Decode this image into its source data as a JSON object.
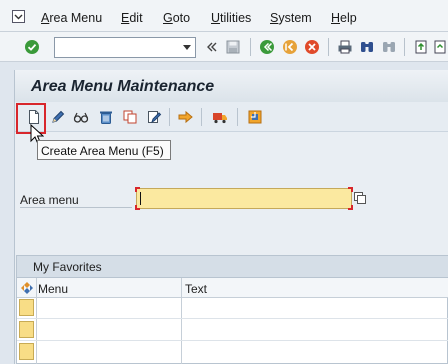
{
  "menubar": {
    "items": [
      {
        "label": "Area Menu"
      },
      {
        "label": "Edit"
      },
      {
        "label": "Goto"
      },
      {
        "label": "Utilities"
      },
      {
        "label": "System"
      },
      {
        "label": "Help"
      }
    ]
  },
  "toolbar": {
    "command_field_value": ""
  },
  "page": {
    "title": "Area Menu Maintenance"
  },
  "tooltip": {
    "text": "Create Area Menu   (F5)"
  },
  "form": {
    "area_menu_label": "Area menu",
    "area_menu_value": ""
  },
  "favorites": {
    "title": "My Favorites",
    "columns": [
      "Menu",
      "Text"
    ],
    "rows": [
      {
        "menu": "",
        "text": ""
      },
      {
        "menu": "",
        "text": ""
      },
      {
        "menu": "",
        "text": ""
      }
    ]
  },
  "colors": {
    "highlight": "#d8262b",
    "input_required": "#fbe9a0",
    "enter_green": "#3a9a3a"
  }
}
